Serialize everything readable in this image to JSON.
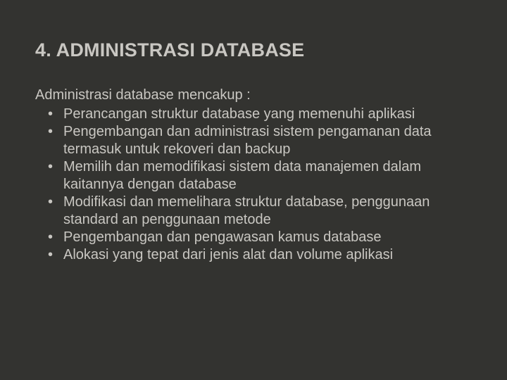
{
  "title": "4. ADMINISTRASI DATABASE",
  "intro": "Administrasi database mencakup :",
  "bullets": [
    "Perancangan struktur database yang memenuhi aplikasi",
    "Pengembangan dan administrasi sistem pengamanan data termasuk untuk rekoveri dan backup",
    "Memilih dan memodifikasi sistem data manajemen dalam kaitannya dengan database",
    "Modifikasi dan memelihara struktur database, penggunaan standard an penggunaan metode",
    "Pengembangan dan pengawasan kamus database",
    "Alokasi yang tepat dari jenis alat dan volume aplikasi"
  ]
}
